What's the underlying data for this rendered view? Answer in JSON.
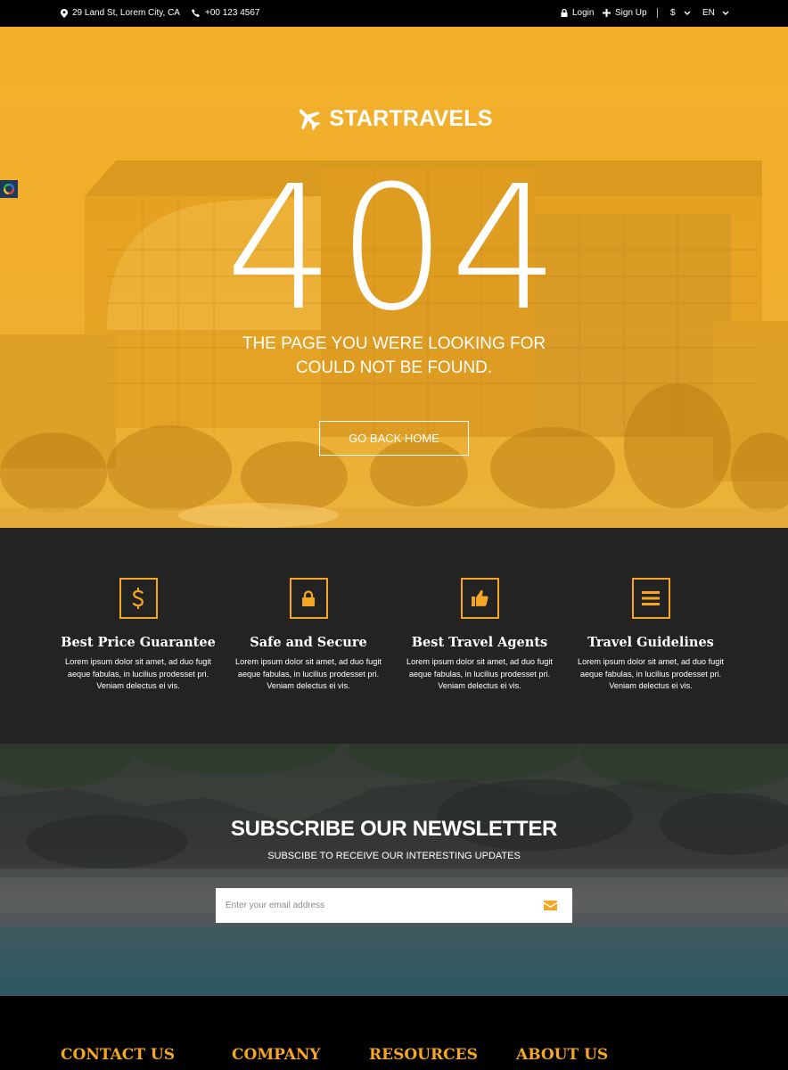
{
  "topbar": {
    "address": "29 Land St, Lorem City, CA",
    "phone": "+00 123 4567",
    "login": "Login",
    "signup": "Sign Up",
    "currency": "$",
    "language": "EN"
  },
  "hero": {
    "brand": "STARTRAVELS",
    "error_code": "404",
    "message_line1": "THE PAGE YOU WERE LOOKING FOR",
    "message_line2": "COULD NOT BE FOUND.",
    "button": "GO BACK HOME"
  },
  "features": [
    {
      "icon": "dollar-icon",
      "title": "Best Price Guarantee",
      "text": "Lorem ipsum dolor sit amet, ad duo fugit aeque fabulas, in lucilius prodesset pri. Veniam delectus ei vis."
    },
    {
      "icon": "lock-icon",
      "title": "Safe and Secure",
      "text": "Lorem ipsum dolor sit amet, ad duo fugit aeque fabulas, in lucilius prodesset pri. Veniam delectus ei vis."
    },
    {
      "icon": "thumbs-up-icon",
      "title": "Best Travel Agents",
      "text": "Lorem ipsum dolor sit amet, ad duo fugit aeque fabulas, in lucilius prodesset pri. Veniam delectus ei vis."
    },
    {
      "icon": "menu-lines-icon",
      "title": "Travel Guidelines",
      "text": "Lorem ipsum dolor sit amet, ad duo fugit aeque fabulas, in lucilius prodesset pri. Veniam delectus ei vis."
    }
  ],
  "newsletter": {
    "title": "SUBSCRIBE OUR NEWSLETTER",
    "subtitle": "SUBSCIBE TO RECEIVE OUR INTERESTING UPDATES",
    "placeholder": "Enter your email address"
  },
  "footer": {
    "headings": [
      "CONTACT US",
      "COMPANY",
      "RESOURCES",
      "ABOUT US"
    ]
  },
  "colors": {
    "accent": "#f5a623",
    "hero_overlay": "#f2b02a",
    "features_bg": "#232323",
    "topbar_bg": "#000000"
  }
}
